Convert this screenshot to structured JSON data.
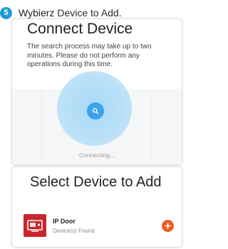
{
  "step": {
    "number": "5",
    "verb": "Wybierz",
    "rest": "Device to Add."
  },
  "connect": {
    "title": "Connect Device",
    "description": "The search process may take up to two minutes. Please do not perform any operations during this time.",
    "status": "Connecting..."
  },
  "select": {
    "title": "Select Device to Add",
    "device": {
      "name": "IP Door",
      "subtitle": "Device(s) Found",
      "icon": "ip-door-icon"
    },
    "add_icon": "plus-icon"
  },
  "colors": {
    "step_badge": "#1f9ad6",
    "scanner": "#b9e0f8",
    "scanner_dot": "#3aa3ea",
    "device_icon": "#c9252a",
    "add_button": "#ee5a24"
  }
}
